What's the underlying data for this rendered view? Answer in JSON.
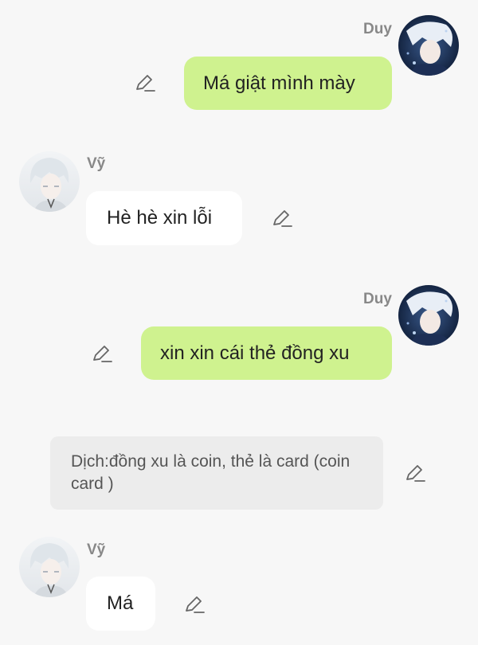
{
  "messages": [
    {
      "sender": "Duy",
      "text": "Má giật mình mày",
      "icon": "edit-icon"
    },
    {
      "sender": "Vỹ",
      "text": "Hè hè xin lỗi",
      "icon": "edit-icon"
    },
    {
      "sender": "Duy",
      "text": "xin xin cái thẻ đồng xu",
      "icon": "edit-icon"
    },
    {
      "sender": "Vỹ",
      "text": "Má",
      "icon": "edit-icon"
    }
  ],
  "note": {
    "text": "Dịch:đồng xu là coin, thẻ là card (coin card )",
    "icon": "edit-icon"
  },
  "colors": {
    "right_bubble": "#cff28f",
    "left_bubble": "#ffffff",
    "background": "#f7f7f7",
    "note_background": "#ececec"
  }
}
